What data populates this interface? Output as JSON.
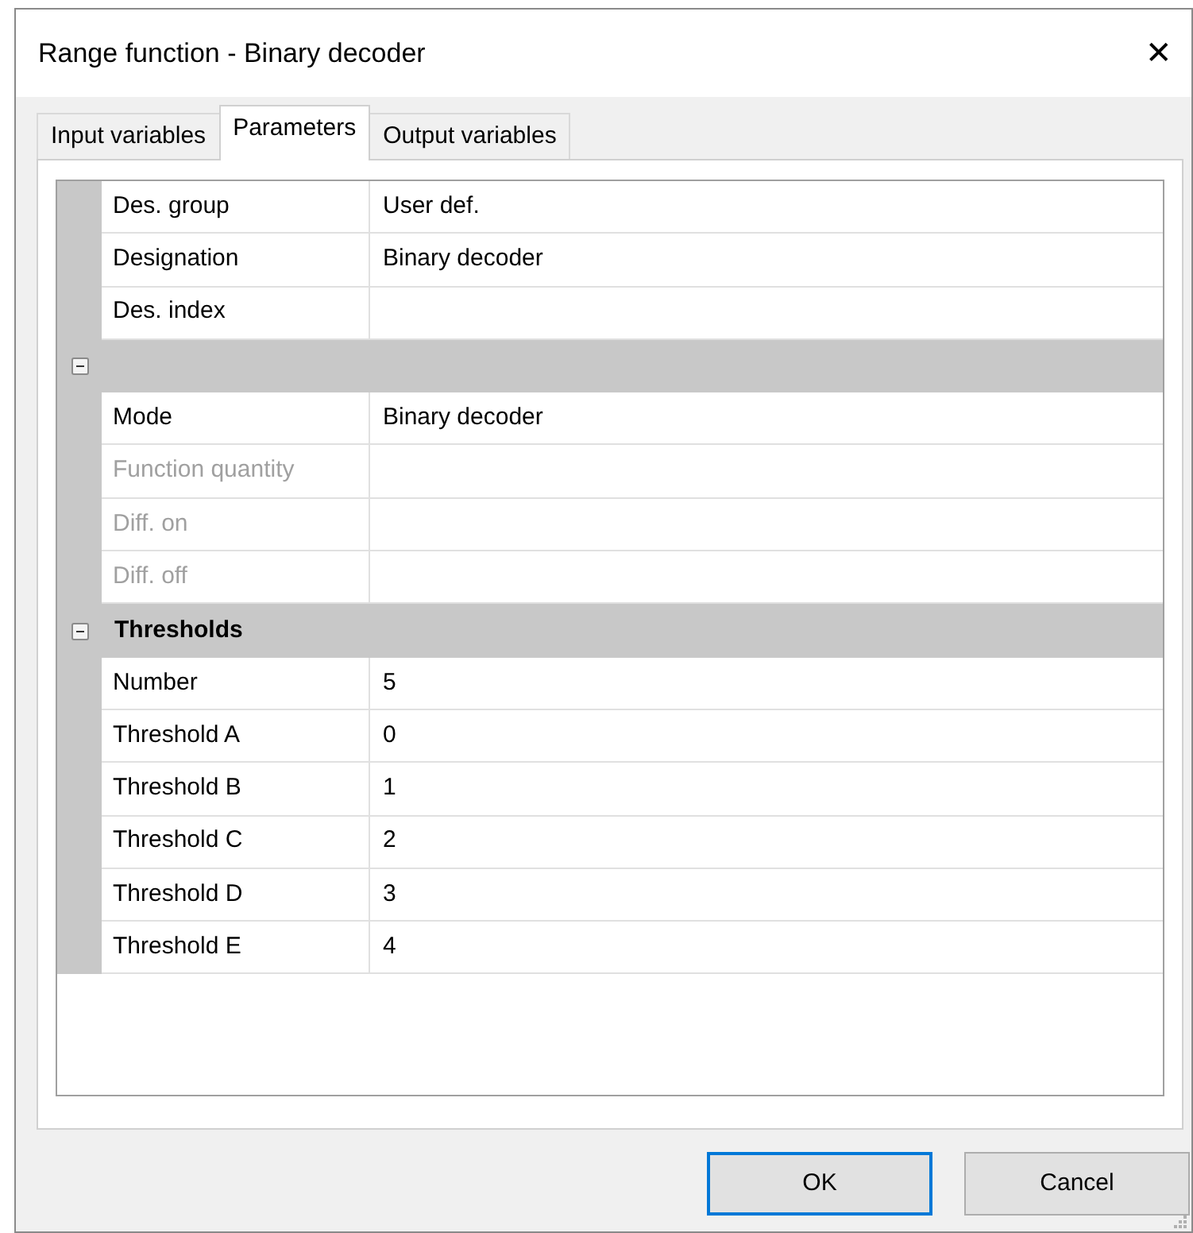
{
  "window": {
    "title": "Range function - Binary decoder",
    "close": "✕"
  },
  "tabs": [
    {
      "label": "Input variables",
      "selected": false
    },
    {
      "label": "Parameters",
      "selected": true
    },
    {
      "label": "Output variables",
      "selected": false
    }
  ],
  "property_grid": {
    "sections": [
      {
        "kind": "plain",
        "rows": [
          {
            "label": "Des. group",
            "value": "User def.",
            "disabled": false
          },
          {
            "label": "Designation",
            "value": "Binary decoder",
            "disabled": false
          },
          {
            "label": "Des. index",
            "disabled": false
          }
        ]
      },
      {
        "kind": "category",
        "expanded": true,
        "rows": [
          {
            "label": "Mode",
            "value": "Binary decoder",
            "disabled": false
          },
          {
            "label": "Function quantity",
            "disabled": true
          },
          {
            "label": "Diff. on",
            "disabled": true
          },
          {
            "label": "Diff. off",
            "disabled": true
          }
        ]
      },
      {
        "kind": "category",
        "title": "Thresholds",
        "expanded": true,
        "rows": [
          {
            "label": "Number",
            "value": "5",
            "disabled": false
          },
          {
            "label": "Threshold A",
            "value": "0",
            "disabled": false
          },
          {
            "label": "Threshold B",
            "value": "1",
            "disabled": false
          },
          {
            "label": "Threshold C",
            "value": "2",
            "disabled": false
          },
          {
            "label": "Threshold D",
            "value": "3",
            "disabled": false
          },
          {
            "label": "Threshold E",
            "value": "4",
            "disabled": false
          }
        ]
      }
    ]
  },
  "buttons": [
    {
      "label": "OK",
      "default": true
    },
    {
      "label": "Cancel",
      "default": false
    }
  ]
}
